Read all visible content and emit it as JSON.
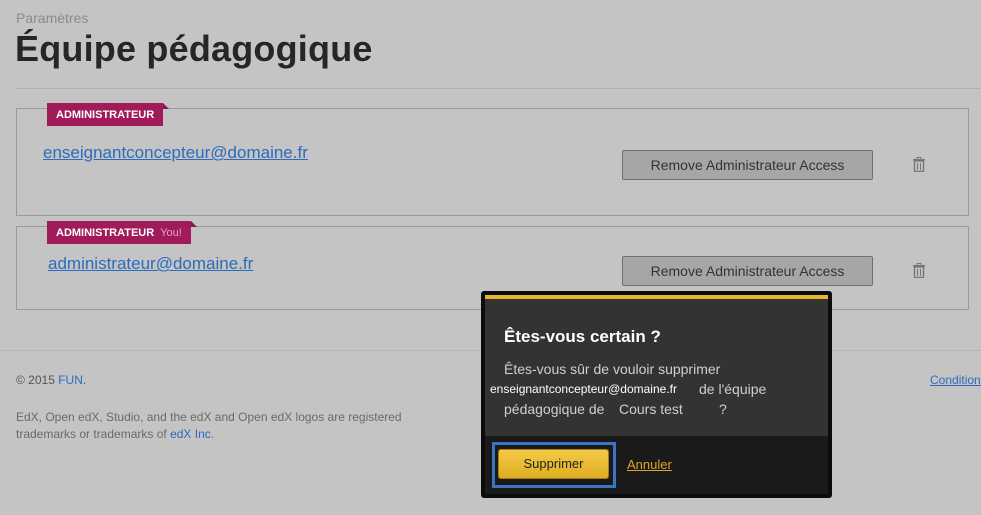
{
  "header": {
    "subtitle": "Paramètres",
    "title": "Équipe pédagogique"
  },
  "members": [
    {
      "role_flag": "Administrateur",
      "you_label": "",
      "email": "enseignantconcepteur@domaine.fr",
      "remove_label": "Remove Administrateur Access",
      "delete_icon": "trash-icon"
    },
    {
      "role_flag": "Administrateur",
      "you_label": "You!",
      "email": "administrateur@domaine.fr",
      "remove_label": "Remove Administrateur Access",
      "delete_icon": "trash-icon"
    }
  ],
  "footer": {
    "copyright_prefix": "© 2015",
    "copyright_link": "FUN",
    "copyright_suffix": ".",
    "legal_text": "EdX, Open edX, Studio, and the edX and Open edX logos are registered trademarks or trademarks of",
    "legal_link": "edX Inc",
    "legal_suffix": ".",
    "conditions_link": "Conditions"
  },
  "dialog": {
    "title": "Êtes-vous certain ?",
    "line1": "Êtes-vous sûr de vouloir supprimer",
    "email": "enseignantconcepteur@domaine.fr",
    "line2_suffix": "de l'équipe",
    "line3_prefix": "pédagogique de",
    "course": "Cours test",
    "question_mark": "?",
    "confirm_label": "Supprimer",
    "cancel_label": "Annuler"
  },
  "colors": {
    "flag": "#a11a5a",
    "link": "#2d6bbd",
    "dialog_accent": "#e7b330",
    "focus": "#3a74c2"
  }
}
